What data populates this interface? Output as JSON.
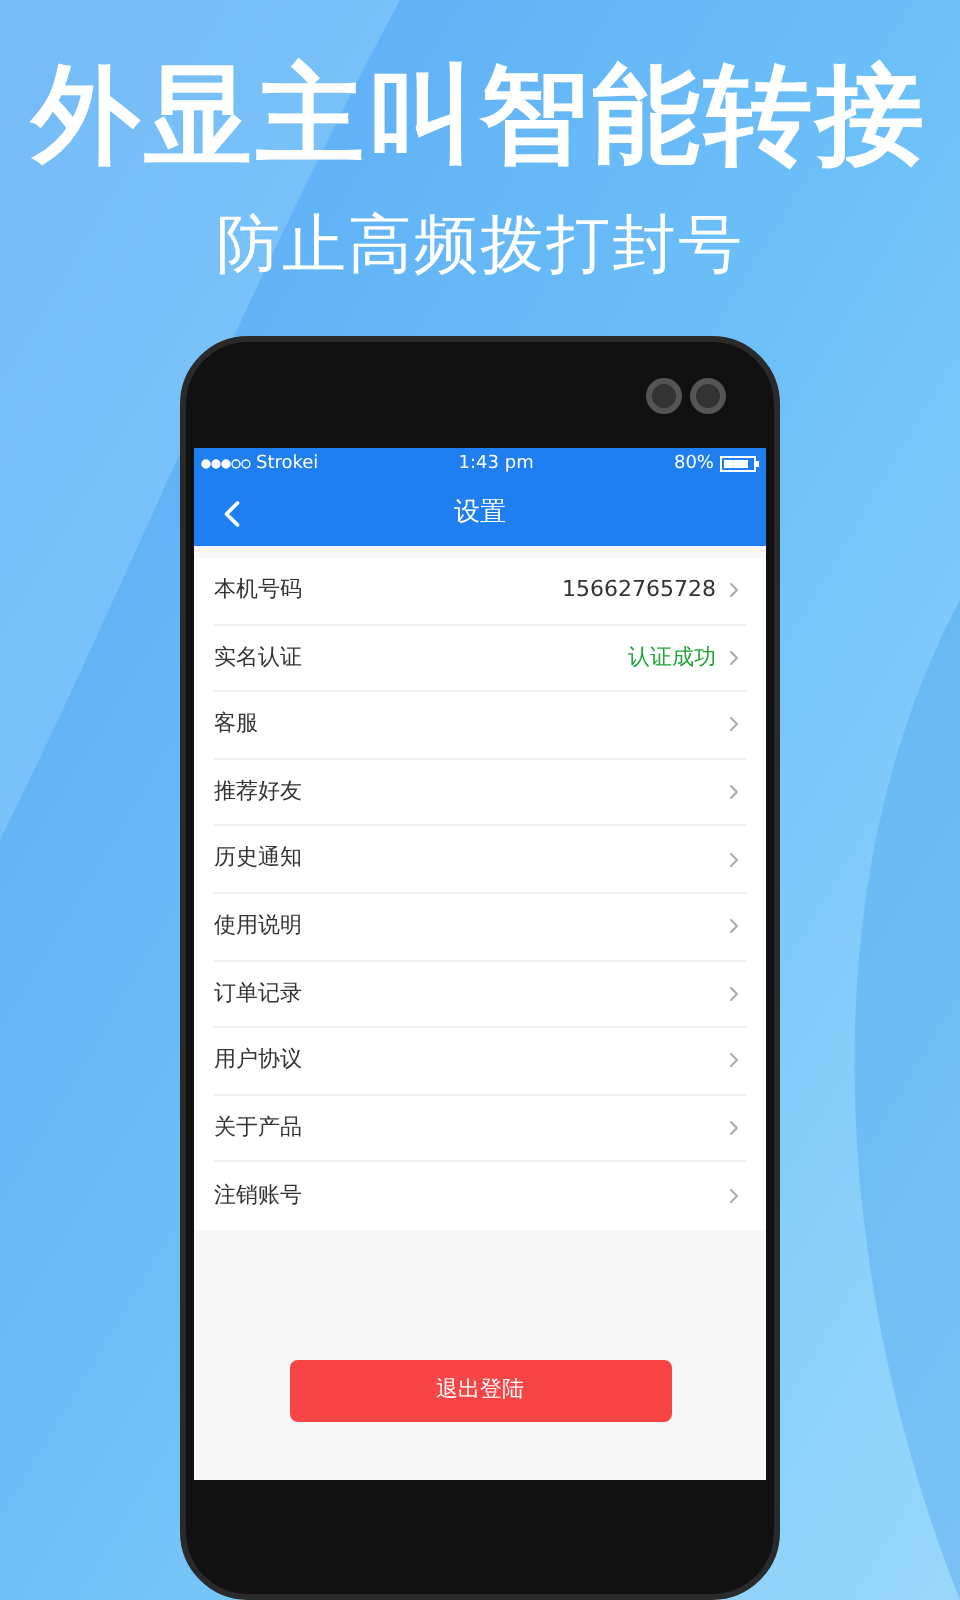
{
  "headline": "外显主叫智能转接",
  "subtitle": "防止高频拨打封号",
  "status_bar": {
    "carrier": "Strokei",
    "time": "1:43 pm",
    "battery": "80%"
  },
  "nav": {
    "title": "设置"
  },
  "rows": [
    {
      "label": "本机号码",
      "value": "15662765728",
      "color": "#333333"
    },
    {
      "label": "实名认证",
      "value": "认证成功",
      "color": "#22a33a"
    },
    {
      "label": "客服"
    },
    {
      "label": "推荐好友"
    },
    {
      "label": "历史通知"
    },
    {
      "label": "使用说明"
    },
    {
      "label": "订单记录"
    },
    {
      "label": "用户协议"
    },
    {
      "label": "关于产品"
    },
    {
      "label": "注销账号"
    }
  ],
  "logout_button": "退出登陆"
}
